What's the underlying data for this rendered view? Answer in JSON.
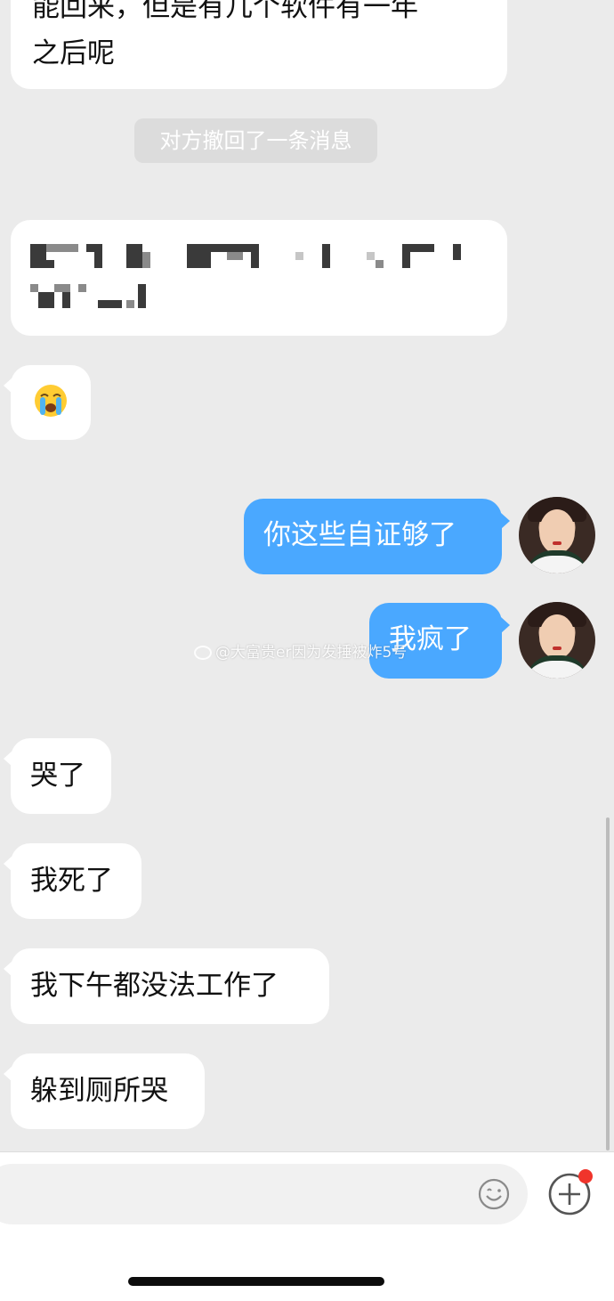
{
  "chat": {
    "top_message_line1": "能回来，但是有几个软件有一年",
    "top_message_line2": "之后呢",
    "recall_notice": "对方撤回了一条消息",
    "sent": [
      {
        "text": "你这些自证够了"
      },
      {
        "text": "我疯了"
      }
    ],
    "received": [
      {
        "text": "哭了"
      },
      {
        "text": "我死了"
      },
      {
        "text": "我下午都没法工作了"
      },
      {
        "text": "躲到厕所哭"
      }
    ],
    "crying_emoji_icon": "loudly-crying-face-icon"
  },
  "watermark": {
    "text": "@大富贵er因为发捶被炸5号",
    "icon": "weibo-icon"
  },
  "composer": {
    "emoji_icon": "smiley-icon",
    "plus_icon": "plus-circle-icon",
    "badge_color": "#f0342b"
  },
  "colors": {
    "background": "#ebebeb",
    "incoming_bubble": "#ffffff",
    "outgoing_bubble": "#4aa8ff"
  }
}
